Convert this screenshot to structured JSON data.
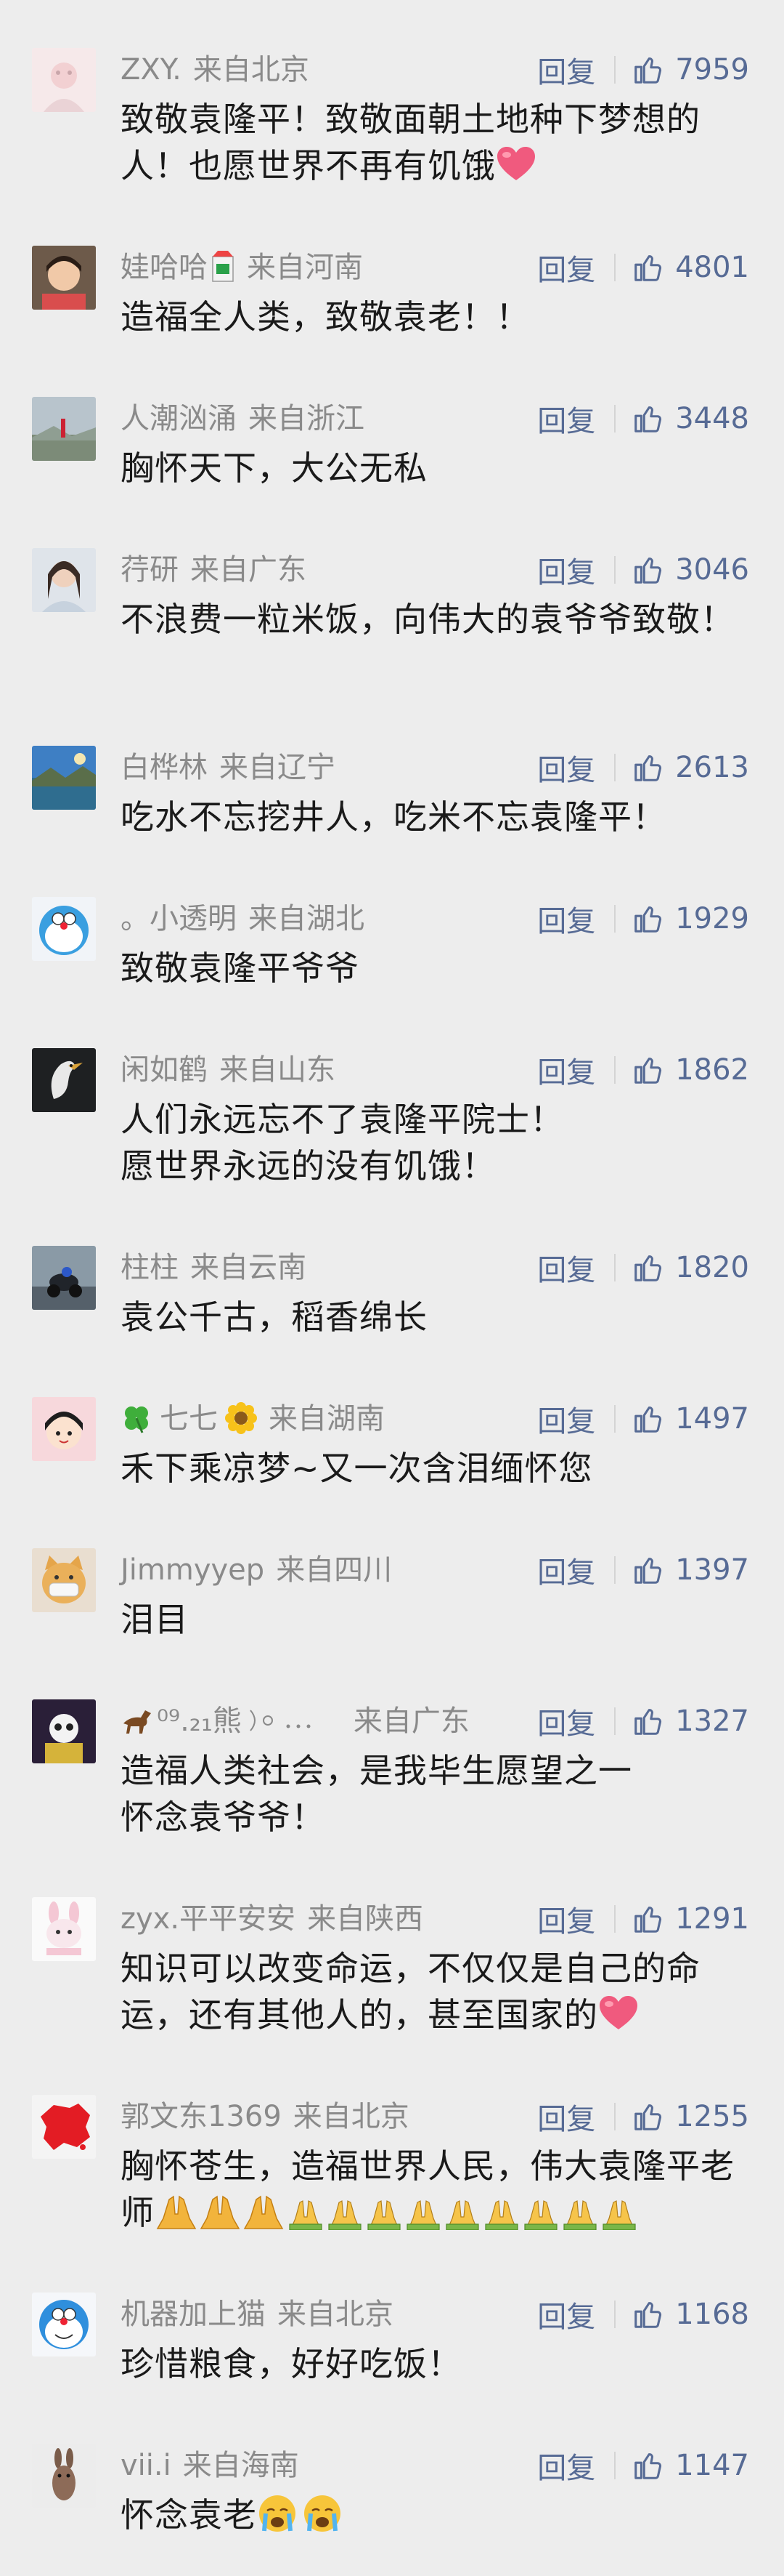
{
  "reply_label": "回复",
  "accent": "#576b95",
  "comments": [
    {
      "user": "ZXY.",
      "location": "来自北京",
      "likes": "7959",
      "text": "致敬袁隆平！致敬面朝土地种下梦想的人！也愿世界不再有饥饿",
      "emoji": "heart-emoji"
    },
    {
      "user": "娃哈哈",
      "location": "来自河南",
      "likes": "4801",
      "text": "造福全人类，致敬袁老！！"
    },
    {
      "user": "人潮汹涌",
      "location": "来自浙江",
      "likes": "3448",
      "text": "胸怀天下，大公无私"
    },
    {
      "user": "荇研",
      "location": "来自广东",
      "likes": "3046",
      "text": "不浪费一粒米饭，向伟大的袁爷爷致敬！"
    },
    {
      "user": "白桦林",
      "location": "来自辽宁",
      "likes": "2613",
      "text": "吃水不忘挖井人，吃米不忘袁隆平！"
    },
    {
      "user": "。小透明",
      "location": "来自湖北",
      "likes": "1929",
      "text": "致敬袁隆平爷爷"
    },
    {
      "user": "闲如鹤",
      "location": "来自山东",
      "likes": "1862",
      "text": "人们永远忘不了袁隆平院士！\n愿世界永远的没有饥饿！"
    },
    {
      "user": "柱柱",
      "location": "来自云南",
      "likes": "1820",
      "text": "袁公千古，稻香绵长"
    },
    {
      "user": "七七",
      "location": "来自湖南",
      "likes": "1497",
      "text": "禾下乘凉梦~又一次含泪缅怀您"
    },
    {
      "user": "Jimmyyep",
      "location": "来自四川",
      "likes": "1397",
      "text": "泪目"
    },
    {
      "user": "⁰⁹.₂₁熊",
      "location": "来自广东",
      "likes": "1327",
      "text": "造福人类社会，是我毕生愿望之一\n怀念袁爷爷！"
    },
    {
      "user": "zyx.平平安安",
      "location": "来自陕西",
      "likes": "1291",
      "text": "知识可以改变命运，不仅仅是自己的命运，还有其他人的，甚至国家的",
      "emoji": "heart-emoji"
    },
    {
      "user": "郭文东1369",
      "location": "来自北京",
      "likes": "1255",
      "text": "胸怀苍生，造福世界人民，伟大袁隆平老师",
      "emoji": "folded-hands-emoji"
    },
    {
      "user": "机器加上猫",
      "location": "来自北京",
      "likes": "1168",
      "text": "珍惜粮食，好好吃饭！"
    },
    {
      "user": "vii.i",
      "location": "来自海南",
      "likes": "1147",
      "text": "怀念袁老",
      "emoji": "crying-face-emoji"
    }
  ]
}
